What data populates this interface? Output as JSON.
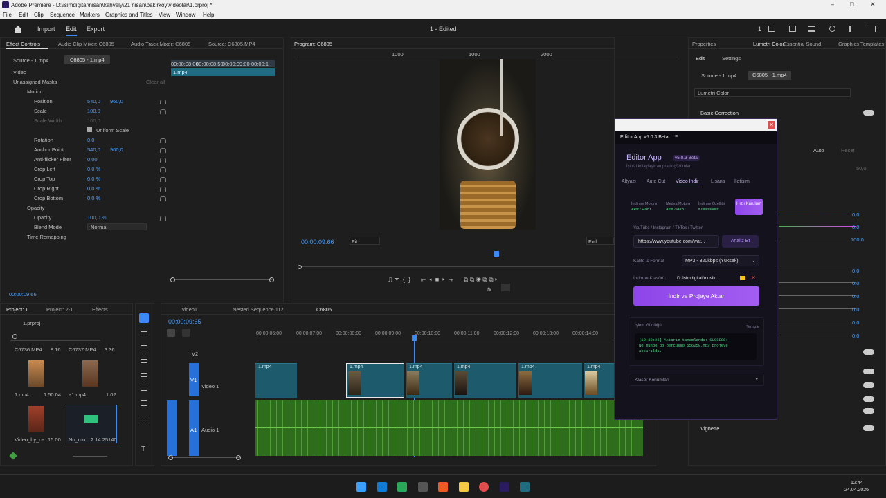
{
  "window": {
    "title": "Adobe Premiere - D:\\isimdigital\\nisan\\kahvely\\21 nisan\\bakirköy\\videolar\\1.prproj *"
  },
  "menu": [
    "File",
    "Edit",
    "Clip",
    "Sequence",
    "Markers",
    "Graphics and Titles",
    "View",
    "Window",
    "Help"
  ],
  "appbar": {
    "home": "home-icon",
    "import": "Import",
    "edit": "Edit",
    "export": "Export",
    "title": "1 - Edited",
    "count": "1"
  },
  "effect_controls": {
    "tabs": [
      "Effect Controls",
      "Audio Clip Mixer: C6805",
      "Audio Track Mixer: C6805",
      "Source: C6805.MP4"
    ],
    "source_label": "Source - 1.mp4",
    "seq_label": "C6805 - 1.mp4",
    "clip_name": "1.mp4",
    "time_a": "00:00:08:00",
    "time_b": "00:00:08:50",
    "time_c": "00:00:09:00",
    "time_d": "00:00:1",
    "video_label": "Video",
    "unassigned": "Unassigned Masks",
    "clear_all": "Clear all",
    "motion": "Motion",
    "position": "Position",
    "position_x": "540,0",
    "position_y": "960,0",
    "scale": "Scale",
    "scale_v": "100,0",
    "scale_width": "Scale Width",
    "scale_width_v": "100,0",
    "uniform": "Uniform Scale",
    "rotation": "Rotation",
    "rotation_v": "0,0",
    "anchor": "Anchor Point",
    "anchor_x": "540,0",
    "anchor_y": "960,0",
    "antiflicker": "Anti-flicker Filter",
    "antiflicker_v": "0,00",
    "crop_left": "Crop Left",
    "crop_left_v": "0,0 %",
    "crop_top": "Crop Top",
    "crop_top_v": "0,0 %",
    "crop_right": "Crop Right",
    "crop_right_v": "0,0 %",
    "crop_bottom": "Crop Bottom",
    "crop_bottom_v": "0,0 %",
    "opacity_group": "Opacity",
    "opacity": "Opacity",
    "opacity_v": "100,0 %",
    "blend": "Blend Mode",
    "blend_v": "Normal",
    "time_remap": "Time Remapping",
    "current_time": "00:00:09:66"
  },
  "program": {
    "tab": "Program: C6805",
    "ruler": [
      "1000",
      "1000",
      "2000",
      "1000"
    ],
    "timecode": "00:00:09:66",
    "fit": "Fit",
    "full": "Full"
  },
  "project": {
    "tabs": [
      "Project: 1",
      "Project: 2-1",
      "Effects"
    ],
    "file": "1.prproj",
    "items": [
      {
        "name": "C6736.MP4",
        "dur": "8:16"
      },
      {
        "name": "C6737.MP4",
        "dur": "3:36"
      },
      {
        "name": "1.mp4",
        "dur": "1:50:04"
      },
      {
        "name": "a1.mp4",
        "dur": "1:02"
      },
      {
        "name": "Video_by_ca...",
        "dur": "15:00"
      },
      {
        "name": "No_mu...",
        "dur": "2:14:25140"
      }
    ]
  },
  "timeline": {
    "tabs": [
      "video1",
      "Nested Sequence 112",
      "C6805"
    ],
    "timecode": "00:00:09:65",
    "ruler": [
      "00:00:06:00",
      "00:00:07:00",
      "00:00:08:00",
      "00:00:09:00",
      "00:00:10:00",
      "00:00:11:00",
      "00:00:12:00",
      "00:00:13:00",
      "00:00:14:00"
    ],
    "v2": "V2",
    "v1": "V1",
    "video1": "Video 1",
    "a1": "A1",
    "audio1": "Audio 1",
    "clips": [
      "1.mp4",
      "1.mp4",
      "1.mp4",
      "1.mp4",
      "1.mp4",
      "1.mp4"
    ]
  },
  "lumetri": {
    "tabs": [
      "Properties",
      "Lumetri Color",
      "Essential Sound",
      "Graphics Templates"
    ],
    "edit": "Edit",
    "settings": "Settings",
    "source_label": "Source - 1.mp4",
    "seq_label": "C6805 - 1.mp4",
    "preset": "Lumetri Color",
    "basic": "Basic Correction",
    "auto": "Auto",
    "reset": "Reset",
    "val_50": "50,0",
    "vals": [
      "0,0",
      "0,0",
      "100,0",
      "0,0",
      "0,0",
      "0,0",
      "0,0",
      "0,0",
      "0,0"
    ],
    "vignette": "Vignette"
  },
  "editor_app": {
    "window_title": "Editor App v5.0.3 Beta",
    "app_name": "Editor App",
    "version": "v5.0.3 Beta",
    "tagline": "İşinizi kolaylaştıran pratik çözümler.",
    "tabs": [
      "Altyazı",
      "Auto Cut",
      "Video İndir",
      "Lisans",
      "İletişim"
    ],
    "status": [
      {
        "label": "İndirme Motoru",
        "value": "Aktif / Hazır"
      },
      {
        "label": "Medya Motoru",
        "value": "Aktif / Hazır"
      },
      {
        "label": "İndirme Özelliği",
        "value": "Kullanılabilir"
      }
    ],
    "quick_setup": "Hızlı Kurulum",
    "platforms": "YouTube / Instagram / TikTok / Twitter",
    "url": "https://www.youtube.com/wat...",
    "analyze": "Analiz Et",
    "quality_label": "Kalite & Format",
    "quality_value": "MP3 - 320kbps (Yüksek)",
    "folder_label": "İndirme Klasörü:",
    "folder_value": "D:/isimdigital/musikl...",
    "download_btn": "İndir ve Projeye Aktar",
    "log_title": "İşlem Günlüğü",
    "log_clear": "Temizle",
    "log_text": "[12:39:26] Aktarım tamamlandı: SUCCESS: No_mundo_do_percusso_556250.mp3 projeye aktarıldı.",
    "folder_locations": "Klasör Konumları"
  },
  "taskbar": {
    "time": "12:44",
    "date": "24.04.2026"
  }
}
